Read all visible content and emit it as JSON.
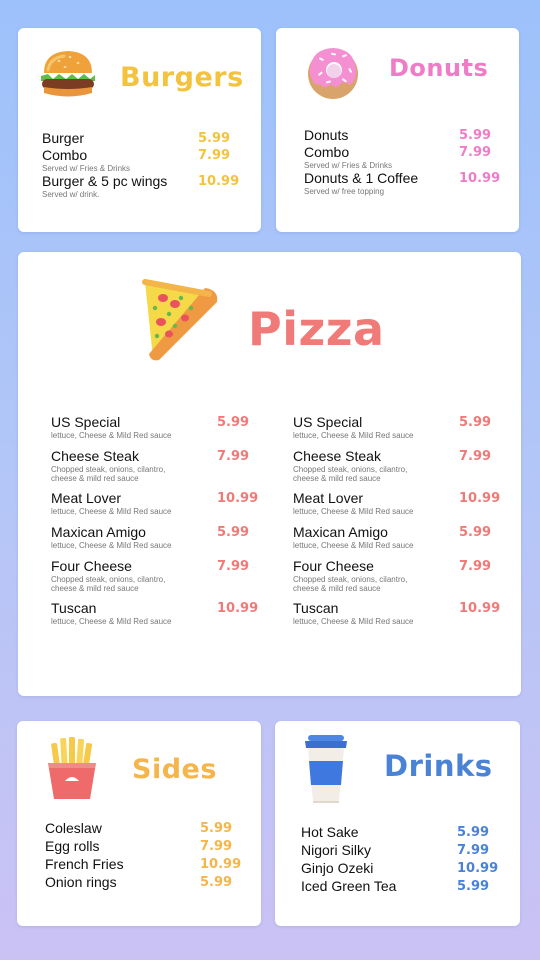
{
  "colors": {
    "burgers": "#f3c23f",
    "donuts": "#f07cc8",
    "pizza": "#ef7a78",
    "sides": "#f5b54b",
    "drinks": "#4a82d6"
  },
  "burgers": {
    "title": "Burgers",
    "icon": "burger-icon",
    "items": [
      {
        "name": "Burger",
        "desc": "",
        "price": "5.99"
      },
      {
        "name": "Combo",
        "desc": "Served w/ Fries & Drinks",
        "price": "7.99"
      },
      {
        "name": "Burger & 5 pc wings",
        "desc": "Served w/ drink.",
        "price": "10.99"
      }
    ]
  },
  "donuts": {
    "title": "Donuts",
    "icon": "donut-icon",
    "items": [
      {
        "name": "Donuts",
        "desc": "",
        "price": "5.99"
      },
      {
        "name": "Combo",
        "desc": "Served w/ Fries & Drinks",
        "price": "7.99"
      },
      {
        "name": "Donuts & 1 Coffee",
        "desc": "Served w/ free topping",
        "price": "10.99"
      }
    ]
  },
  "pizza": {
    "title": "Pizza",
    "icon": "pizza-slice-icon",
    "left": [
      {
        "name": "US Special",
        "desc": "lettuce, Cheese & Mild Red sauce",
        "price": "5.99"
      },
      {
        "name": "Cheese Steak",
        "desc": "Chopped steak, onions, cilantro, cheese & mild red sauce",
        "price": "7.99"
      },
      {
        "name": "Meat Lover",
        "desc": "lettuce, Cheese & Mild Red sauce",
        "price": "10.99"
      },
      {
        "name": "Maxican Amigo",
        "desc": "lettuce, Cheese & Mild Red sauce",
        "price": "5.99"
      },
      {
        "name": "Four Cheese",
        "desc": "Chopped steak, onions, cilantro, cheese & mild red sauce",
        "price": "7.99"
      },
      {
        "name": "Tuscan",
        "desc": "lettuce, Cheese & Mild Red sauce",
        "price": "10.99"
      }
    ],
    "right": [
      {
        "name": "US Special",
        "desc": "lettuce, Cheese & Mild Red sauce",
        "price": "5.99"
      },
      {
        "name": "Cheese Steak",
        "desc": "Chopped steak, onions, cilantro, cheese & mild red sauce",
        "price": "7.99"
      },
      {
        "name": "Meat Lover",
        "desc": "lettuce, Cheese & Mild Red sauce",
        "price": "10.99"
      },
      {
        "name": "Maxican Amigo",
        "desc": "lettuce, Cheese & Mild Red sauce",
        "price": "5.99"
      },
      {
        "name": "Four Cheese",
        "desc": "Chopped steak, onions, cilantro, cheese & mild red sauce",
        "price": "7.99"
      },
      {
        "name": "Tuscan",
        "desc": "lettuce, Cheese & Mild Red sauce",
        "price": "10.99"
      }
    ]
  },
  "sides": {
    "title": "Sides",
    "icon": "french-fries-icon",
    "items": [
      {
        "name": "Coleslaw",
        "desc": "",
        "price": "5.99"
      },
      {
        "name": "Egg rolls",
        "desc": "",
        "price": "7.99"
      },
      {
        "name": "French Fries",
        "desc": "",
        "price": "10.99"
      },
      {
        "name": "Onion rings",
        "desc": "",
        "price": "5.99"
      }
    ]
  },
  "drinks": {
    "title": "Drinks",
    "icon": "coffee-cup-icon",
    "items": [
      {
        "name": "Hot Sake",
        "desc": "",
        "price": "5.99"
      },
      {
        "name": "Nigori Silky",
        "desc": "",
        "price": "7.99"
      },
      {
        "name": "Ginjo Ozeki",
        "desc": "",
        "price": "10.99"
      },
      {
        "name": "Iced Green Tea",
        "desc": "",
        "price": "5.99"
      }
    ]
  }
}
